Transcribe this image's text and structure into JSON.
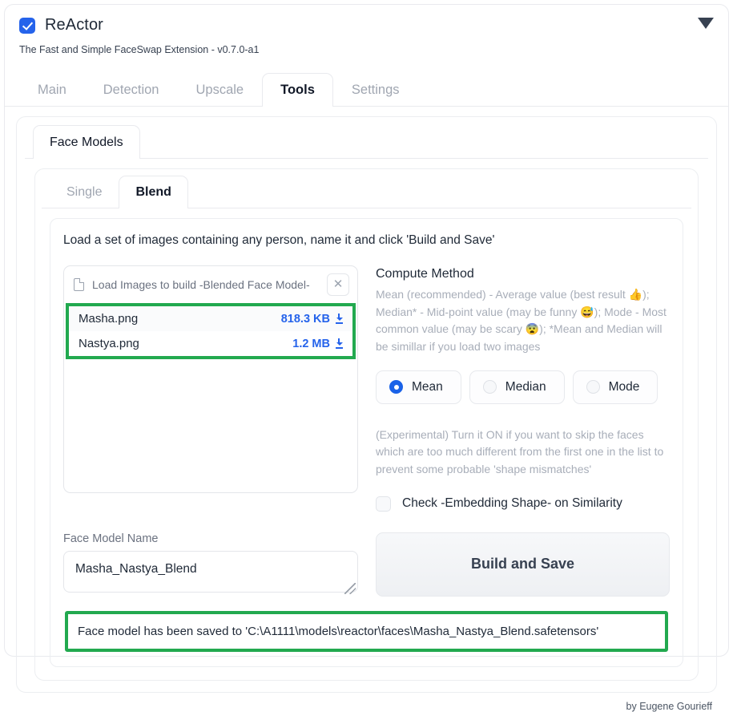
{
  "app": {
    "title": "ReActor",
    "subtitle": "The Fast and Simple FaceSwap Extension - v0.7.0-a1",
    "checkbox_checked": true,
    "collapse_icon": "chevron-down-icon",
    "footer": "by Eugene Gourieff"
  },
  "main_tabs": [
    {
      "label": "Main",
      "active": false
    },
    {
      "label": "Detection",
      "active": false
    },
    {
      "label": "Upscale",
      "active": false
    },
    {
      "label": "Tools",
      "active": true
    },
    {
      "label": "Settings",
      "active": false
    }
  ],
  "section_tab": {
    "label": "Face Models"
  },
  "sub_tabs": [
    {
      "label": "Single",
      "active": false
    },
    {
      "label": "Blend",
      "active": true
    }
  ],
  "blend": {
    "instructions": "Load a set of images containing any person, name it and click 'Build and Save'",
    "upload": {
      "label": "Load Images to build -Blended Face Model-",
      "file_icon": "file-icon",
      "clear_icon": "close-icon",
      "files": [
        {
          "name": "Masha.png",
          "size": "818.3 KB",
          "download_icon": "download-icon"
        },
        {
          "name": "Nastya.png",
          "size": "1.2 MB",
          "download_icon": "download-icon"
        }
      ]
    },
    "compute": {
      "title": "Compute Method",
      "description": "Mean (recommended) - Average value (best result 👍); Median* - Mid-point value (may be funny 😅); Mode - Most common value (may be scary 😨); *Mean and Median will be simillar if you load two images",
      "options": [
        {
          "label": "Mean",
          "selected": true
        },
        {
          "label": "Median",
          "selected": false
        },
        {
          "label": "Mode",
          "selected": false
        }
      ]
    },
    "similarity": {
      "description": "(Experimental) Turn it ON if you want to skip the faces which are too much different from the first one in the list to prevent some probable 'shape mismatches'",
      "checkbox_label": "Check -Embedding Shape- on Similarity",
      "checked": false
    },
    "name_field": {
      "label": "Face Model Name",
      "value": "Masha_Nastya_Blend",
      "placeholder": "Face Model Name"
    },
    "build_button": "Build and Save",
    "status": "Face model has been saved to 'C:\\A1111\\models\\reactor\\faces\\Masha_Nastya_Blend.safetensors'"
  },
  "colors": {
    "accent_blue": "#2563eb",
    "highlight_green": "#22a94f",
    "muted_text": "#a8aeb9"
  }
}
